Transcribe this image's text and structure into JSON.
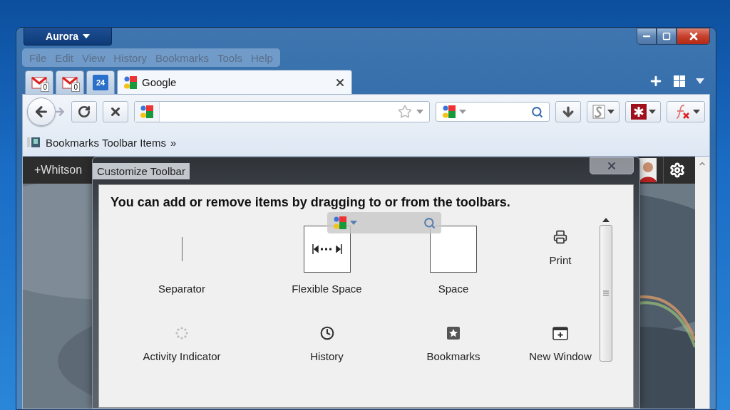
{
  "app_button": {
    "label": "Aurora"
  },
  "menu": [
    {
      "label": "File"
    },
    {
      "label": "Edit"
    },
    {
      "label": "View"
    },
    {
      "label": "History"
    },
    {
      "label": "Bookmarks"
    },
    {
      "label": "Tools"
    },
    {
      "label": "Help"
    }
  ],
  "tabs": [
    {
      "kind": "mail",
      "badge": "0",
      "selected": false
    },
    {
      "kind": "mail",
      "badge": "0",
      "selected": false
    },
    {
      "kind": "calendar",
      "badge": "24",
      "selected": false
    },
    {
      "kind": "page",
      "label": "Google",
      "selected": true
    }
  ],
  "bookmarks_bar": {
    "label": "Bookmarks Toolbar Items",
    "chevron": "»"
  },
  "page": {
    "profile_label": "+Whitson"
  },
  "dialog": {
    "title": "Customize Toolbar",
    "heading": "You can add or remove items by dragging to or from the toolbars.",
    "items": [
      {
        "kind": "separator",
        "label": "Separator"
      },
      {
        "kind": "flexible-space",
        "label": "Flexible Space"
      },
      {
        "kind": "space",
        "label": "Space"
      },
      {
        "kind": "print",
        "label": "Print"
      },
      {
        "kind": "activity",
        "label": "Activity Indicator"
      },
      {
        "kind": "history",
        "label": "History"
      },
      {
        "kind": "bookmarks",
        "label": "Bookmarks"
      },
      {
        "kind": "new-window",
        "label": "New Window"
      }
    ]
  }
}
